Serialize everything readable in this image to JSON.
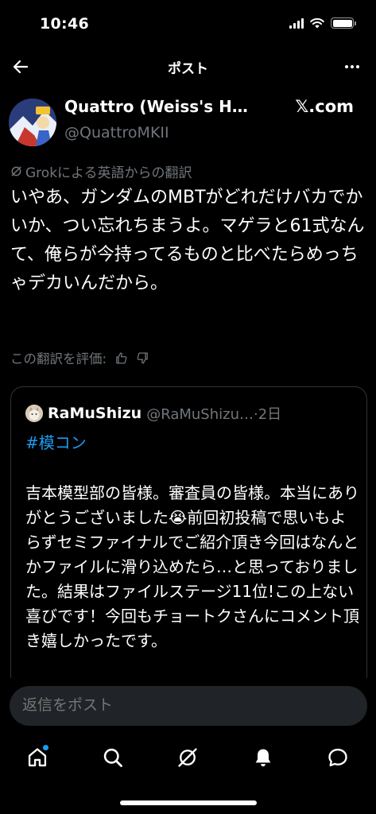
{
  "status": {
    "time": "10:46"
  },
  "header": {
    "title": "ポスト"
  },
  "post": {
    "author_name": "Quattro (Weiss's H…",
    "author_handle": "@QuattroMKII",
    "source": "𝕏.com",
    "translate_note": "Grokによる英語からの翻訳",
    "text": "いやあ、ガンダムのMBTがどれだけバカでかいか、つい忘れちまうよ。マゲラと61式なんて、俺らが今持ってるものと比べたらめっちゃデカいんだから。",
    "rate_label": "この翻訳を評価:"
  },
  "quote": {
    "name": "RaMuShizu",
    "meta": "@RaMuShizu…·2日",
    "hashtag": "#模コン",
    "body": "吉本模型部の皆様。審査員の皆様。本当にありがとうございました😭前回初投稿で思いもよらずセミファイナルでご紹介頂き今回はなんとかファイルに滑り込めたら…と思っておりました。結果はファイルステージ11位!この上ない喜びです！今回もチョートクさんにコメント頂き嬉しかったです。"
  },
  "reply": {
    "placeholder": "返信をポスト"
  },
  "colors": {
    "accent": "#1d9bf0",
    "muted": "#71767b",
    "background": "#000000"
  }
}
